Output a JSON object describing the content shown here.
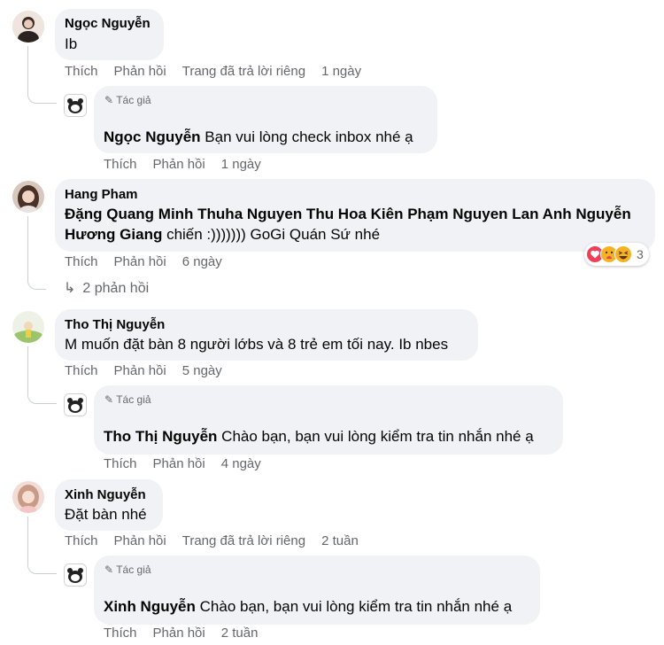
{
  "comments": [
    {
      "author": "Ngọc Nguyễn",
      "text": "Ib",
      "actions": {
        "like": "Thích",
        "reply": "Phản hồi",
        "private": "Trang đã trả lời riêng",
        "time": "1 ngày"
      },
      "reply": {
        "author_tag": "Tác giả",
        "mention": "Ngọc Nguyễn",
        "text": "Bạn vui lòng check inbox nhé ạ",
        "actions": {
          "like": "Thích",
          "reply": "Phản hồi",
          "time": "1 ngày"
        }
      }
    },
    {
      "author": "Hang Pham",
      "mentions_line1": "Đặng Quang Minh Thuha Nguyen Thu Hoa Kiên Phạm Nguyen Lan Anh Nguyễn",
      "mentions_line2": "Hương Giang",
      "text_after": " chiến :))))))) GoGi Quán Sứ nhé",
      "actions": {
        "like": "Thích",
        "reply": "Phản hồi",
        "time": "6 ngày"
      },
      "reaction_count": "3",
      "replies_link": "2 phản hồi"
    },
    {
      "author": "Tho Thị Nguyễn",
      "text": "M muốn đặt bàn 8 người lớbs và 8 trẻ em tối nay. Ib nbes",
      "actions": {
        "like": "Thích",
        "reply": "Phản hồi",
        "time": "5 ngày"
      },
      "reply": {
        "author_tag": "Tác giả",
        "mention": "Tho Thị Nguyễn",
        "text": " Chào bạn, bạn vui lòng kiểm tra tin nhắn nhé ạ",
        "actions": {
          "like": "Thích",
          "reply": "Phản hồi",
          "time": "4 ngày"
        }
      }
    },
    {
      "author": "Xinh Nguyễn",
      "text": "Đặt bàn nhé",
      "actions": {
        "like": "Thích",
        "reply": "Phản hồi",
        "private": "Trang đã trả lời riêng",
        "time": "2 tuần"
      },
      "reply": {
        "author_tag": "Tác giả",
        "mention": "Xinh Nguyễn",
        "text": " Chào bạn, bạn vui lòng kiểm tra tin nhắn nhé ạ",
        "actions": {
          "like": "Thích",
          "reply": "Phản hồi",
          "time": "2 tuần"
        }
      }
    }
  ],
  "colors": {
    "bubble": "#f0f2f5",
    "meta": "#65676b",
    "text": "#050505",
    "like": "#f33e58",
    "haha": "#f7b125"
  }
}
